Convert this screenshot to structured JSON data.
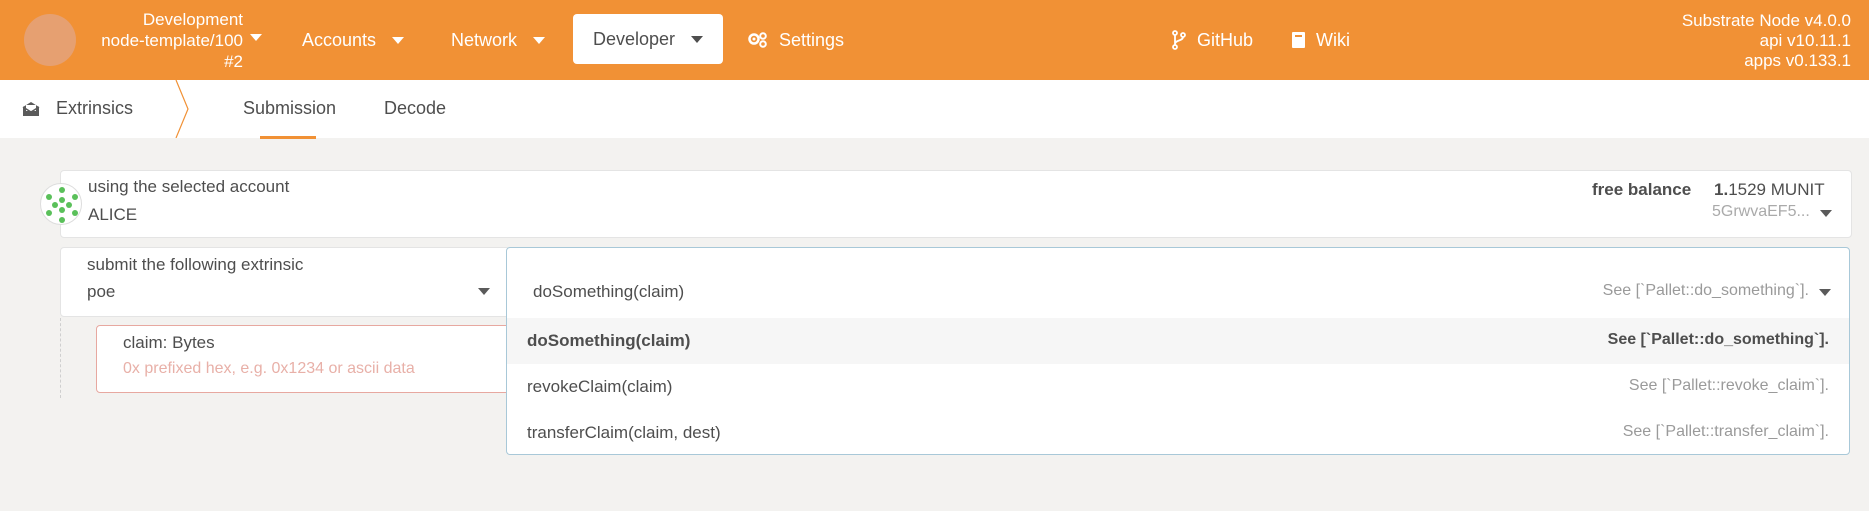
{
  "topbar": {
    "chain_name": "Development",
    "chain_node": "node-template/100",
    "chain_block": "#2",
    "nav": {
      "accounts": "Accounts",
      "network": "Network",
      "developer": "Developer",
      "settings": "Settings",
      "github": "GitHub",
      "wiki": "Wiki"
    },
    "node_version": "Substrate Node v4.0.0",
    "api_version": "api v10.11.1",
    "apps_version": "apps v0.133.1",
    "accent_color": "#f19135"
  },
  "subnav": {
    "section": "Extrinsics",
    "tabs": [
      "Submission",
      "Decode"
    ],
    "active_tab": "Submission"
  },
  "account": {
    "label": "using the selected account",
    "value": "ALICE",
    "free_balance_label": "free balance",
    "balance_int": "1.",
    "balance_frac": "1529",
    "balance_unit": "MUNIT",
    "address": "5GrwvaEF5..."
  },
  "extrinsic": {
    "label": "submit the following extrinsic",
    "module": "poe",
    "selected_call": "doSomething(claim)",
    "selected_hint": "See [`Pallet::do_something`].",
    "param_label": "claim: Bytes",
    "param_placeholder": "0x prefixed hex, e.g. 0x1234 or ascii data",
    "options": [
      {
        "name": "doSomething(claim)",
        "hint": "See [`Pallet::do_something`]."
      },
      {
        "name": "revokeClaim(claim)",
        "hint": "See [`Pallet::revoke_claim`]."
      },
      {
        "name": "transferClaim(claim, dest)",
        "hint": "See [`Pallet::transfer_claim`]."
      }
    ]
  }
}
